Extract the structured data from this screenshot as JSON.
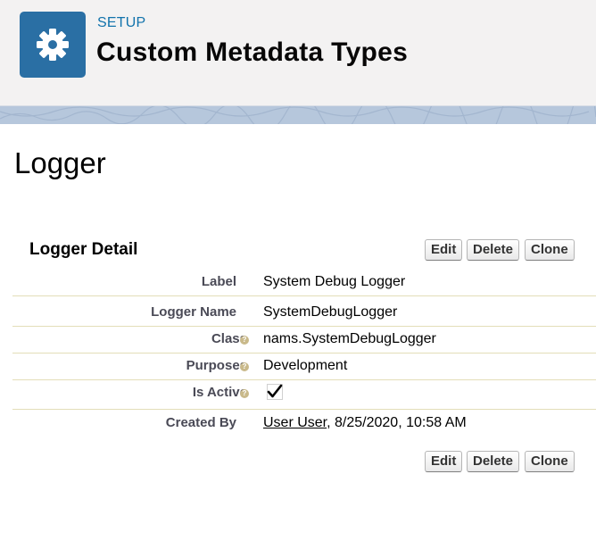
{
  "header": {
    "eyebrow": "SETUP",
    "title": "Custom Metadata Types",
    "icon": "gear-icon",
    "accent": "#2a6fa4"
  },
  "record": {
    "title": "Logger"
  },
  "detail": {
    "section_title": "Logger Detail",
    "buttons": {
      "edit": "Edit",
      "delete": "Delete",
      "clone": "Clone"
    },
    "fields": {
      "label": {
        "name": "Label",
        "value": "System Debug Logger"
      },
      "logger_name": {
        "name": "Logger Name",
        "value": "SystemDebugLogger"
      },
      "class": {
        "name": "Class",
        "value": "nams.SystemDebugLogger"
      },
      "purposes": {
        "name": "Purposes",
        "value": "Development"
      },
      "is_active": {
        "name": "Is Active",
        "checked": true
      },
      "created_by": {
        "name": "Created By",
        "user": "User User",
        "date": ", 8/25/2020, 10:58 AM"
      }
    }
  }
}
